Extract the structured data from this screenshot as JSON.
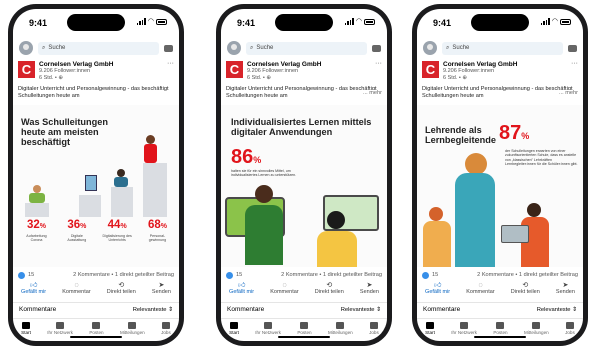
{
  "status": {
    "time": "9:41"
  },
  "search": {
    "placeholder": "Suche"
  },
  "post": {
    "company": "Cornelsen Verlag GmbH",
    "logo_letter": "C",
    "followers": "9.206 Follower:innen",
    "age": "6 Std. • ",
    "text": "Digitaler Unterricht und Personalgewinnung - das beschäftigt Schulleitungen heute am",
    "more": "... mehr",
    "more_short": "... mehr"
  },
  "slides": [
    {
      "title": "Was Schulleitungen heute am meisten beschäftigt",
      "bars": [
        {
          "value": "32",
          "unit": "%",
          "label": "Aufarbeitung Corona"
        },
        {
          "value": "36",
          "unit": "%",
          "label": "Digitale Ausstattung"
        },
        {
          "value": "44",
          "unit": "%",
          "label": "Digitalisierung des Unterrichts"
        },
        {
          "value": "68",
          "unit": "%",
          "label": "Personal-gewinnung"
        }
      ]
    },
    {
      "title": "Individualisiertes Lernen mittels digitaler Anwendungen",
      "value": "86",
      "unit": "%",
      "caption": "halten sie für ein sinnvolles Mittel, um individualisiertes Lernen zu unterstützen."
    },
    {
      "title": "Lehrende als Lernbegleitende",
      "value": "87",
      "unit": "%",
      "caption": "der Schulleitungen erwarten von einer zukunftsorientierten Schule, dass es anstelle von „klassischen\" Lehrkräften Lernbegleiter:innen für die Schüler:innen gibt."
    }
  ],
  "stats": {
    "likes": "15",
    "comments": "2 Kommentare • 1 direkt geteilter Beitrag"
  },
  "actions": [
    {
      "icon": "thumbs-up-icon",
      "label": "Gefällt mir"
    },
    {
      "icon": "comment-icon",
      "label": "Kommentar"
    },
    {
      "icon": "repost-icon",
      "label": "Direkt teilen"
    },
    {
      "icon": "send-icon",
      "label": "Senden"
    }
  ],
  "comments": {
    "label": "Kommentare",
    "sort": "Relevanteste ⇕"
  },
  "tabs": [
    "Start",
    "Ihr Netzwerk",
    "Posten",
    "Mitteilungen",
    "Jobs"
  ],
  "colors": {
    "brand": "#d8232a",
    "accent_red": "#e1141b",
    "link_blue": "#0a66c2"
  }
}
